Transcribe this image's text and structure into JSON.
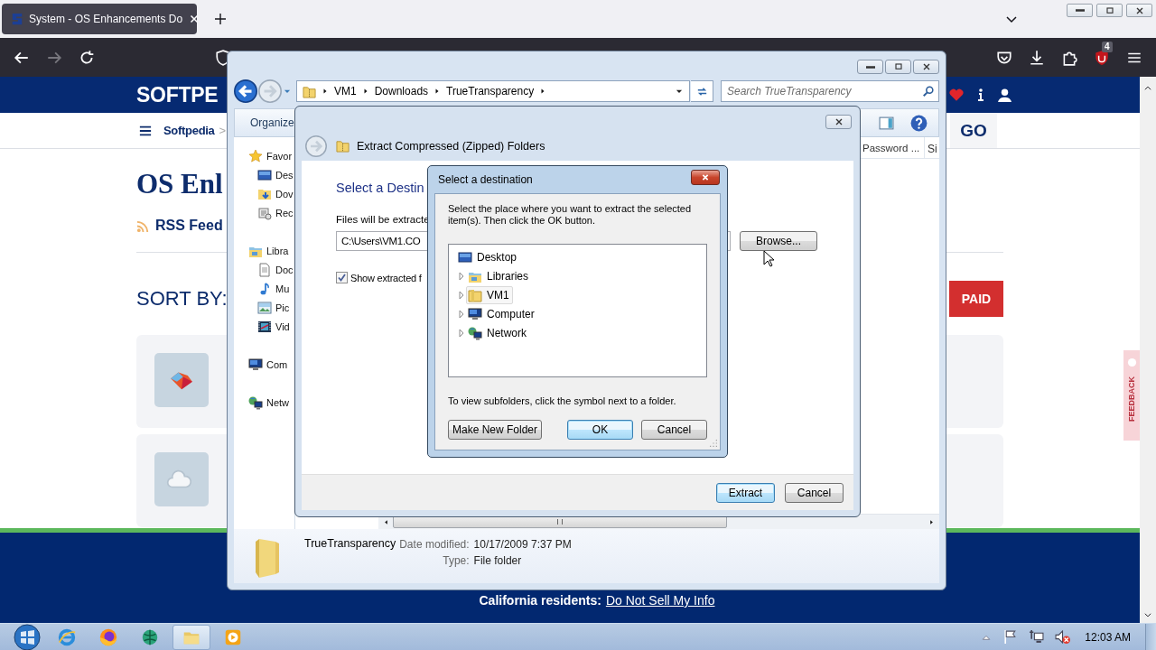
{
  "browser": {
    "tabs": [
      {
        "title": "System - OS Enhancements Do",
        "selected": true
      }
    ],
    "extension_badge": "4"
  },
  "website": {
    "logo": "SOFTPE",
    "breadcrumb": [
      "Softpedia",
      ">"
    ],
    "go_button": "GO",
    "heading": "OS Enl",
    "rss": "RSS Feed",
    "sort_label": "SORT BY:",
    "filter_button": "PAID",
    "cards": [
      {
        "kind": "gem"
      },
      {
        "kind": "cloud"
      }
    ],
    "feedback": "FEEDBACK",
    "footer": {
      "label": "California residents:",
      "link": "Do Not Sell My Info"
    }
  },
  "explorer": {
    "breadcrumb": [
      "VM1",
      "Downloads",
      "TrueTransparency"
    ],
    "search": {
      "placeholder": "Search TrueTransparency"
    },
    "toolbar": [
      "Organize"
    ],
    "nav_items": [
      {
        "label": "Favor",
        "kind": "star",
        "children": [
          {
            "label": "Des",
            "kind": "desktop"
          },
          {
            "label": "Dov",
            "kind": "downloads"
          },
          {
            "label": "Rec",
            "kind": "recent"
          }
        ]
      },
      {
        "label": "Libra",
        "kind": "library",
        "children": [
          {
            "label": "Doc",
            "kind": "documents"
          },
          {
            "label": "Mu",
            "kind": "music"
          },
          {
            "label": "Pic",
            "kind": "pictures"
          },
          {
            "label": "Vid",
            "kind": "videos"
          }
        ]
      },
      {
        "label": "Com",
        "kind": "computer"
      },
      {
        "label": "Netw",
        "kind": "network"
      }
    ],
    "columns": [
      "Password ...",
      "Si"
    ],
    "details": {
      "name": "TrueTransparency",
      "fields": [
        {
          "label": "Date modified:",
          "value": "10/17/2009 7:37 PM"
        },
        {
          "label": "Type:",
          "value": "File folder"
        }
      ]
    }
  },
  "extract_dialog": {
    "title": "Extract Compressed (Zipped) Folders",
    "heading": "Select a Destin",
    "path_label": "Files will be extracte",
    "path": {
      "value": "C:\\Users\\VM1.CO"
    },
    "show_files": {
      "label": "Show extracted f",
      "checked": true
    },
    "browse_button": "Browse...",
    "buttons": [
      {
        "label": "Extract",
        "default": true
      },
      {
        "label": "Cancel",
        "default": false
      }
    ]
  },
  "folder_dialog": {
    "title": "Select a destination",
    "instructions": "Select the place where you want to extract the selected item(s).  Then click the OK button.",
    "tree": [
      {
        "label": "Desktop",
        "kind": "desktop",
        "selected": false,
        "children": [
          {
            "label": "Libraries",
            "kind": "library",
            "expanded": false,
            "selected": false
          },
          {
            "label": "VM1",
            "kind": "user",
            "expanded": false,
            "selected": true
          },
          {
            "label": "Computer",
            "kind": "computer",
            "expanded": false,
            "selected": false
          },
          {
            "label": "Network",
            "kind": "network",
            "expanded": false,
            "selected": false
          }
        ]
      }
    ],
    "hint": "To view subfolders, click the symbol next to a folder.",
    "buttons": [
      {
        "label": "Make New Folder",
        "default": false
      },
      {
        "label": "OK",
        "default": true
      },
      {
        "label": "Cancel",
        "default": false
      }
    ]
  },
  "taskbar": {
    "apps": [
      {
        "kind": "ie",
        "active": false
      },
      {
        "kind": "firefox",
        "active": false
      },
      {
        "kind": "globe",
        "active": false
      },
      {
        "kind": "folder",
        "active": true
      },
      {
        "kind": "media",
        "active": false
      }
    ],
    "clock": "12:03 AM"
  }
}
